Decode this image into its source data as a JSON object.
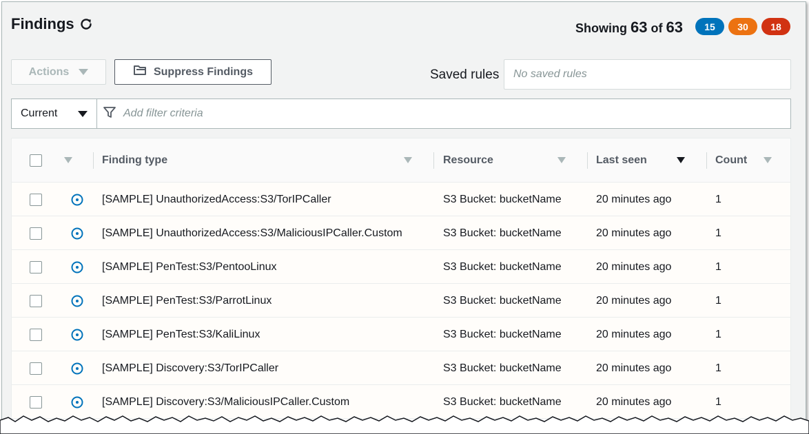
{
  "header": {
    "title": "Findings",
    "refresh_icon": "refresh-icon",
    "showing_prefix": "Showing",
    "showing_count": "63",
    "showing_of": "of",
    "showing_total": "63"
  },
  "badges": [
    {
      "value": "15",
      "color": "#0073bb"
    },
    {
      "value": "30",
      "color": "#ec7211"
    },
    {
      "value": "18",
      "color": "#d13212"
    }
  ],
  "toolbar": {
    "actions_label": "Actions",
    "suppress_label": "Suppress Findings",
    "suppress_icon": "folder-icon",
    "saved_rules_label": "Saved rules",
    "saved_rules_placeholder": "No saved rules"
  },
  "filter": {
    "selected": "Current",
    "placeholder": "Add filter criteria",
    "icon": "filter-icon"
  },
  "table": {
    "columns": [
      "Finding type",
      "Resource",
      "Last seen",
      "Count"
    ],
    "sorted_column": "Last seen",
    "rows": [
      {
        "finding_type": "[SAMPLE] UnauthorizedAccess:S3/TorIPCaller",
        "resource": "S3 Bucket: bucketName",
        "last_seen": "20 minutes ago",
        "count": "1"
      },
      {
        "finding_type": "[SAMPLE] UnauthorizedAccess:S3/MaliciousIPCaller.Custom",
        "resource": "S3 Bucket: bucketName",
        "last_seen": "20 minutes ago",
        "count": "1"
      },
      {
        "finding_type": "[SAMPLE] PenTest:S3/PentooLinux",
        "resource": "S3 Bucket: bucketName",
        "last_seen": "20 minutes ago",
        "count": "1"
      },
      {
        "finding_type": "[SAMPLE] PenTest:S3/ParrotLinux",
        "resource": "S3 Bucket: bucketName",
        "last_seen": "20 minutes ago",
        "count": "1"
      },
      {
        "finding_type": "[SAMPLE] PenTest:S3/KaliLinux",
        "resource": "S3 Bucket: bucketName",
        "last_seen": "20 minutes ago",
        "count": "1"
      },
      {
        "finding_type": "[SAMPLE] Discovery:S3/TorIPCaller",
        "resource": "S3 Bucket: bucketName",
        "last_seen": "20 minutes ago",
        "count": "1"
      },
      {
        "finding_type": "[SAMPLE] Discovery:S3/MaliciousIPCaller.Custom",
        "resource": "S3 Bucket: bucketName",
        "last_seen": "20 minutes ago",
        "count": "1"
      }
    ],
    "severity_icon": "low-severity-icon",
    "severity_color": "#0073bb"
  }
}
